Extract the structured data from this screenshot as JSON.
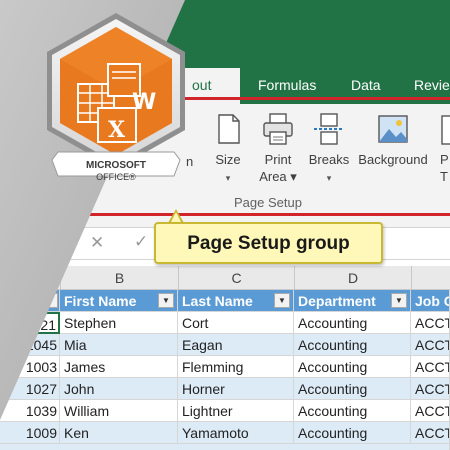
{
  "ribbon": {
    "tabs": [
      {
        "label": "out",
        "active": true
      },
      {
        "label": "Formulas",
        "active": false
      },
      {
        "label": "Data",
        "active": false
      },
      {
        "label": "Revie",
        "active": false
      }
    ],
    "buttons": [
      {
        "label": "n",
        "icon": "orientation-icon"
      },
      {
        "label": "Size",
        "sub": "▾",
        "icon": "size-icon"
      },
      {
        "label": "Print",
        "sub": "Area ▾",
        "icon": "print-area-icon"
      },
      {
        "label": "Breaks",
        "sub": "▾",
        "icon": "breaks-icon"
      },
      {
        "label": "Background",
        "icon": "background-icon"
      },
      {
        "label": "P",
        "sub": "T",
        "icon": "print-titles-icon"
      }
    ],
    "group_label": "Page Setup"
  },
  "formula_bar": {
    "dots": "⋮",
    "cancel": "✕",
    "enter": "✓"
  },
  "callout": {
    "text": "Page Setup group"
  },
  "badge": {
    "line1": "MICROSOFT",
    "line2": "OFFICE®",
    "letter_x": "X",
    "letter_w": "W"
  },
  "columns": [
    "B",
    "C",
    "D"
  ],
  "table": {
    "headers": [
      "e ID",
      "First Name",
      "Last Name",
      "Department",
      "Job C"
    ],
    "rows": [
      [
        "1021",
        "Stephen",
        "Cort",
        "Accounting",
        "ACCT-"
      ],
      [
        "1045",
        "Mia",
        "Eagan",
        "Accounting",
        "ACCT-"
      ],
      [
        "1003",
        "James",
        "Flemming",
        "Accounting",
        "ACCT-"
      ],
      [
        "1027",
        "John",
        "Horner",
        "Accounting",
        "ACCT-"
      ],
      [
        "1039",
        "William",
        "Lightner",
        "Accounting",
        "ACCT-"
      ],
      [
        "1009",
        "Ken",
        "Yamamoto",
        "Accounting",
        "ACCT-"
      ]
    ]
  },
  "colors": {
    "excel_green": "#217346",
    "header_blue": "#5b9bd5",
    "band_blue": "#ddebf7",
    "office_orange": "#e8791e",
    "highlight_red": "#d0262b"
  }
}
